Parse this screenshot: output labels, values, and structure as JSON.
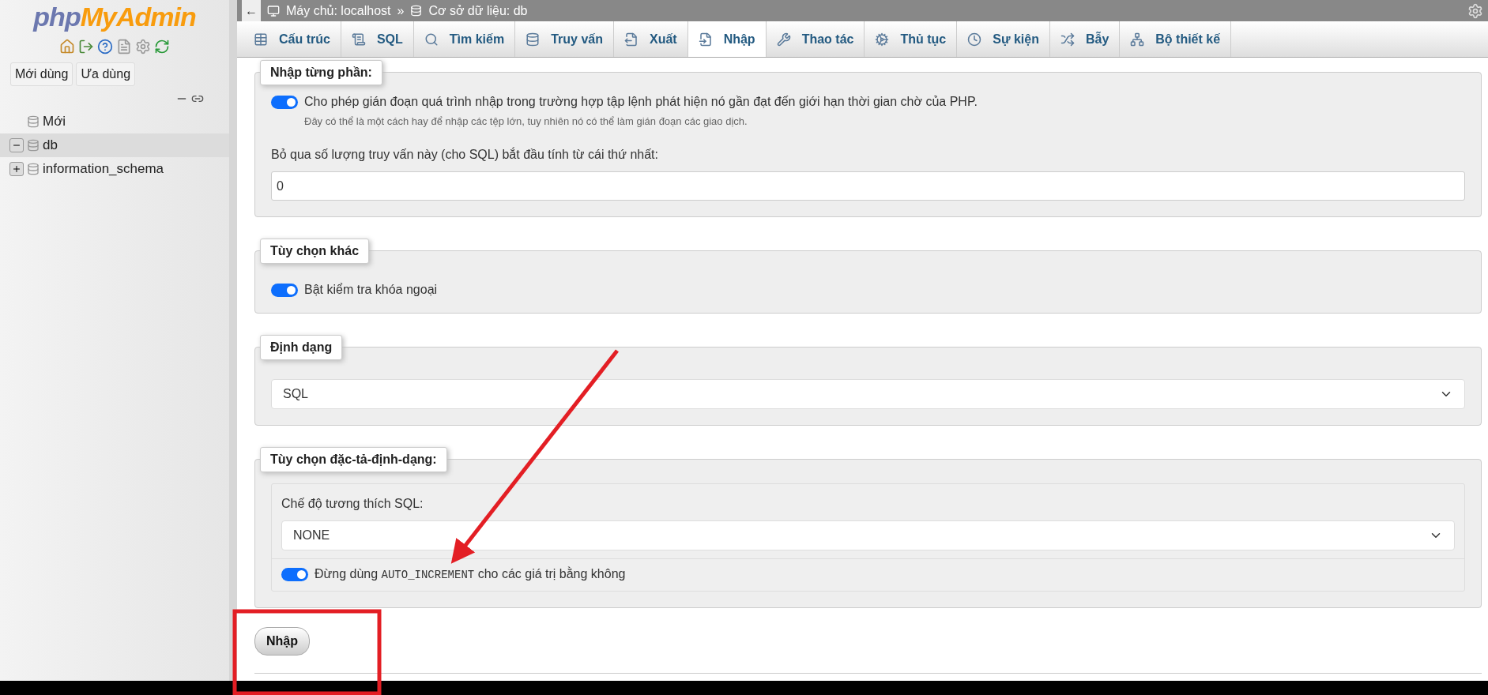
{
  "sidebar": {
    "logo": {
      "part1": "php",
      "part2": "MyAdmin"
    },
    "quick_buttons": [
      "Mới dùng",
      "Ưa dùng"
    ],
    "tree": [
      {
        "label": "Mới",
        "selected": false
      },
      {
        "label": "db",
        "expanded": true,
        "selected": true
      },
      {
        "label": "information_schema",
        "expanded": false,
        "selected": false
      }
    ]
  },
  "breadcrumb": {
    "back": "←",
    "server": "Máy chủ: localhost",
    "separator": "»",
    "database": "Cơ sở dữ liệu: db"
  },
  "tabs": [
    {
      "label": "Cấu trúc",
      "selected": false
    },
    {
      "label": "SQL",
      "selected": false
    },
    {
      "label": "Tìm kiếm",
      "selected": false
    },
    {
      "label": "Truy vấn",
      "selected": false
    },
    {
      "label": "Xuất",
      "selected": false
    },
    {
      "label": "Nhập",
      "selected": true
    },
    {
      "label": "Thao tác",
      "selected": false
    },
    {
      "label": "Thủ tục",
      "selected": false
    },
    {
      "label": "Sự kiện",
      "selected": false
    },
    {
      "label": "Bẫy",
      "selected": false
    },
    {
      "label": "Bộ thiết kế",
      "selected": false
    }
  ],
  "partial_import": {
    "legend": "Nhập từng phần:",
    "toggle": {
      "label": "Cho phép gián đoạn quá trình nhập trong trường hợp tập lệnh phát hiện nó gần đạt đến giới hạn thời gian chờ của PHP.",
      "on": true
    },
    "hint": "Đây có thể là một cách hay để nhập các tệp lớn, tuy nhiên nó có thể làm gián đoạn các giao dịch.",
    "skip_label": "Bỏ qua số lượng truy vấn này (cho SQL) bắt đầu tính từ cái thứ nhất:",
    "skip_value": "0"
  },
  "other_options": {
    "legend": "Tùy chọn khác",
    "toggle": {
      "label": "Bật kiểm tra khóa ngoại",
      "on": true
    }
  },
  "format": {
    "legend": "Định dạng",
    "value": "SQL"
  },
  "format_options": {
    "legend": "Tùy chọn đặc-tả-định-dạng:",
    "compat_label": "Chế độ tương thích SQL:",
    "compat_value": "NONE",
    "toggle": {
      "before": "Đừng dùng",
      "code": "AUTO_INCREMENT",
      "after": "cho các giá trị bằng không",
      "on": true
    }
  },
  "submit": "Nhập"
}
